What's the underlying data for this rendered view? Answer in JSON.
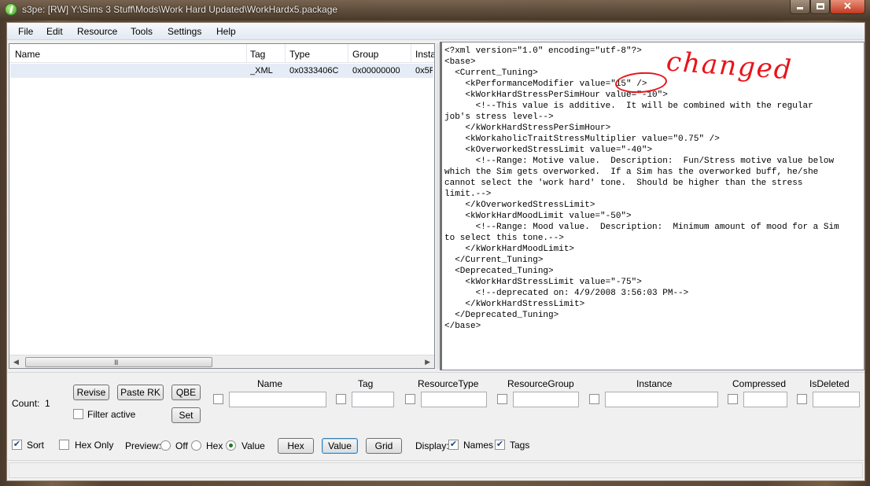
{
  "window": {
    "title": "s3pe: [RW] Y:\\Sims 3 Stuff\\Mods\\Work Hard Updated\\WorkHardx5.package"
  },
  "menu": [
    "File",
    "Edit",
    "Resource",
    "Tools",
    "Settings",
    "Help"
  ],
  "list": {
    "columns": [
      "Name",
      "Tag",
      "Type",
      "Group",
      "Insta"
    ],
    "rows": [
      {
        "name": "",
        "tag": "_XML",
        "type": "0x0333406C",
        "group": "0x00000000",
        "instance": "0x5F"
      }
    ],
    "scroll_grip": "III"
  },
  "preview": {
    "xml_lines": [
      "<?xml version=\"1.0\" encoding=\"utf-8\"?>",
      "<base>",
      "  <Current_Tuning>",
      "    <kPerformanceModifier value=\"15\" />",
      "    <kWorkHardStressPerSimHour value=\"-10\">",
      "      <!--This value is additive.  It will be combined with the regular",
      "job's stress level-->",
      "    </kWorkHardStressPerSimHour>",
      "    <kWorkaholicTraitStressMultiplier value=\"0.75\" />",
      "    <kOverworkedStressLimit value=\"-40\">",
      "      <!--Range: Motive value.  Description:  Fun/Stress motive value below",
      "which the Sim gets overworked.  If a Sim has the overworked buff, he/she",
      "cannot select the 'work hard' tone.  Should be higher than the stress",
      "limit.-->",
      "    </kOverworkedStressLimit>",
      "    <kWorkHardMoodLimit value=\"-50\">",
      "      <!--Range: Mood value.  Description:  Minimum amount of mood for a Sim",
      "to select this tone.-->",
      "    </kWorkHardMoodLimit>",
      "  </Current_Tuning>",
      "  <Deprecated_Tuning>",
      "    <kWorkHardStressLimit value=\"-75\">",
      "      <!--deprecated on: 4/9/2008 3:56:03 PM-->",
      "    </kWorkHardStressLimit>",
      "  </Deprecated_Tuning>",
      "</base>"
    ],
    "annotation_text": "changed",
    "annotation_color": "#e8141a"
  },
  "controls": {
    "count_label": "Count:",
    "count_value": "1",
    "revise": "Revise",
    "paste_rk": "Paste RK",
    "qbe": "QBE",
    "filter_active": "Filter active",
    "set": "Set",
    "filter_headers": [
      "Name",
      "Tag",
      "ResourceType",
      "ResourceGroup",
      "Instance",
      "Compressed",
      "IsDeleted"
    ],
    "sort": "Sort",
    "hex_only": "Hex Only",
    "preview_label": "Preview:",
    "preview_off": "Off",
    "preview_hex": "Hex",
    "preview_value": "Value",
    "btn_hex": "Hex",
    "btn_value": "Value",
    "btn_grid": "Grid",
    "display_label": "Display:",
    "display_names": "Names",
    "display_tags": "Tags",
    "sort_checked": true,
    "hex_only_checked": false,
    "filter_active_checked": false,
    "preview_selected": "Value",
    "names_checked": true,
    "tags_checked": true
  }
}
